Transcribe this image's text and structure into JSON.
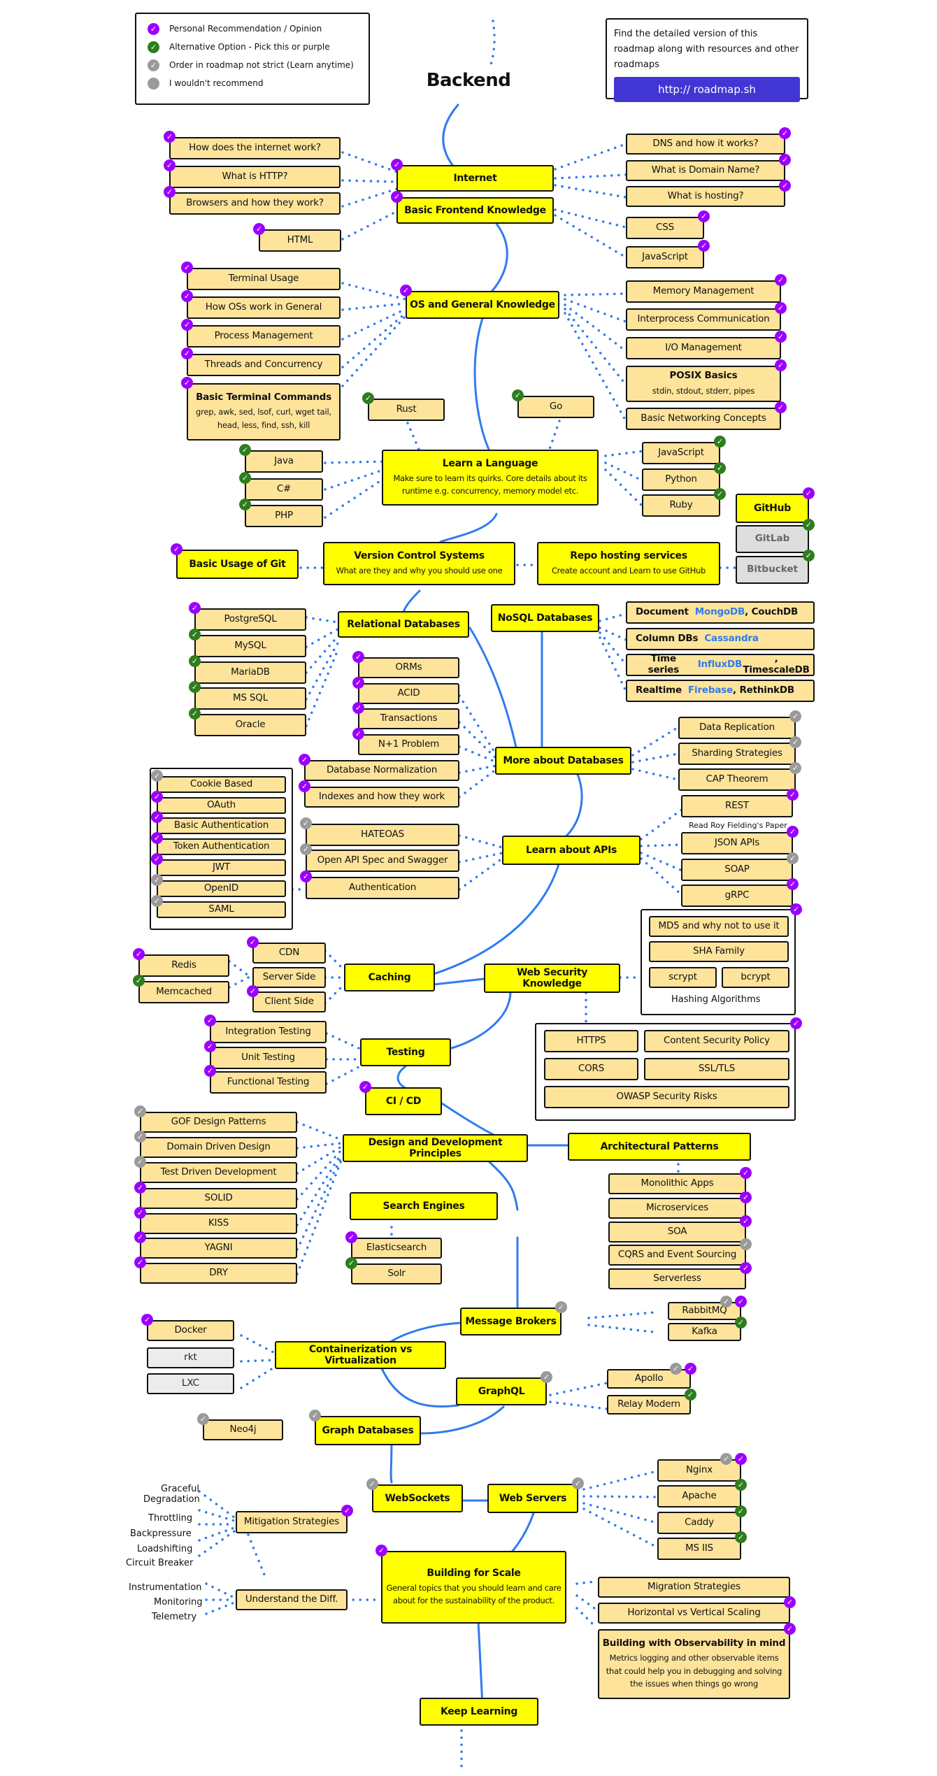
{
  "title": "Backend",
  "legend": [
    {
      "kind": "purple",
      "label": "Personal Recommendation / Opinion"
    },
    {
      "kind": "green",
      "label": "Alternative Option - Pick this or purple"
    },
    {
      "kind": "gray",
      "label": "Order in roadmap not strict (Learn anytime)"
    },
    {
      "kind": "dot",
      "label": "I wouldn't recommend"
    }
  ],
  "promo": {
    "text": "Find the detailed version of this roadmap along with resources and other roadmaps",
    "button": "http:// roadmap.sh"
  },
  "colors": {
    "main_node": "#ffff00",
    "sub_node": "#fee49b",
    "purple_badge": "#9b00ff",
    "green_badge": "#2e7d1e",
    "gray_badge": "#9a9a9a",
    "connector": "#2f7bf0",
    "promo_button": "#4136d4"
  },
  "nodes": {
    "internet": {
      "label": "Internet"
    },
    "how_internet": {
      "label": "How does the internet work?"
    },
    "http": {
      "label": "What is HTTP?"
    },
    "browsers": {
      "label": "Browsers and how they work?"
    },
    "dns": {
      "label": "DNS and how it works?"
    },
    "domain": {
      "label": "What is Domain Name?"
    },
    "hosting": {
      "label": "What is hosting?"
    },
    "frontend": {
      "label": "Basic Frontend Knowledge"
    },
    "html": {
      "label": "HTML"
    },
    "css": {
      "label": "CSS"
    },
    "js_fe": {
      "label": "JavaScript"
    },
    "os": {
      "label": "OS and General Knowledge"
    },
    "terminal": {
      "label": "Terminal Usage"
    },
    "how_os": {
      "label": "How OSs work in General"
    },
    "process": {
      "label": "Process Management"
    },
    "threads": {
      "label": "Threads and Concurrency"
    },
    "term_cmds": {
      "label": "Basic Terminal Commands",
      "desc": "grep, awk, sed, lsof, curl, wget tail, head, less, find, ssh, kill"
    },
    "memory": {
      "label": "Memory Management"
    },
    "ipc": {
      "label": "Interprocess Communication"
    },
    "io": {
      "label": "I/O Management"
    },
    "posix": {
      "label": "POSIX Basics",
      "desc": "stdin, stdout, stderr, pipes"
    },
    "networking": {
      "label": "Basic Networking Concepts"
    },
    "rust": {
      "label": "Rust"
    },
    "go": {
      "label": "Go"
    },
    "language": {
      "label": "Learn a Language",
      "desc": "Make sure to learn its quirks. Core details about its runtime e.g. concurrency, memory model etc."
    },
    "java": {
      "label": "Java"
    },
    "csharp": {
      "label": "C#"
    },
    "php": {
      "label": "PHP"
    },
    "js_be": {
      "label": "JavaScript"
    },
    "python": {
      "label": "Python"
    },
    "ruby": {
      "label": "Ruby"
    },
    "github": {
      "label": "GitHub"
    },
    "gitlab": {
      "label": "GitLab"
    },
    "bitbucket": {
      "label": "Bitbucket"
    },
    "git": {
      "label": "Basic Usage of Git"
    },
    "vcs": {
      "label": "Version Control Systems",
      "desc": "What are they and why you should use one"
    },
    "repo": {
      "label": "Repo hosting services",
      "desc": "Create account and Learn to use GitHub"
    },
    "relational": {
      "label": "Relational Databases"
    },
    "postgres": {
      "label": "PostgreSQL"
    },
    "mysql": {
      "label": "MySQL"
    },
    "mariadb": {
      "label": "MariaDB"
    },
    "mssql": {
      "label": "MS SQL"
    },
    "oracle": {
      "label": "Oracle"
    },
    "nosql": {
      "label": "NoSQL Databases"
    },
    "nosql_doc": {
      "label": "Document",
      "links": "MongoDB",
      "rest": ", CouchDB"
    },
    "nosql_col": {
      "label": "Column DBs",
      "links": "Cassandra",
      "rest": ""
    },
    "nosql_ts": {
      "label": "Time series",
      "links": "InfluxDB",
      "rest": ", TimescaleDB"
    },
    "nosql_rt": {
      "label": "Realtime",
      "links": "Firebase",
      "rest": ", RethinkDB"
    },
    "orms": {
      "label": "ORMs"
    },
    "acid": {
      "label": "ACID"
    },
    "transactions": {
      "label": "Transactions"
    },
    "n1": {
      "label": "N+1 Problem"
    },
    "normalization": {
      "label": "Database Normalization"
    },
    "indexes": {
      "label": "Indexes and how they work"
    },
    "more_db": {
      "label": "More about Databases"
    },
    "replication": {
      "label": "Data Replication"
    },
    "sharding": {
      "label": "Sharding Strategies"
    },
    "cap": {
      "label": "CAP Theorem"
    },
    "cookie": {
      "label": "Cookie Based"
    },
    "oauth": {
      "label": "OAuth"
    },
    "basic_auth": {
      "label": "Basic Authentication"
    },
    "token_auth": {
      "label": "Token Authentication"
    },
    "jwt": {
      "label": "JWT"
    },
    "openid": {
      "label": "OpenID"
    },
    "saml": {
      "label": "SAML"
    },
    "hateoas": {
      "label": "HATEOAS"
    },
    "openapi": {
      "label": "Open API Spec and Swagger"
    },
    "authentication": {
      "label": "Authentication"
    },
    "apis": {
      "label": "Learn about APIs"
    },
    "rest": {
      "label": "REST"
    },
    "rest_hint": {
      "label": "Read Roy Fielding's Paper"
    },
    "json_apis": {
      "label": "JSON APIs"
    },
    "soap": {
      "label": "SOAP"
    },
    "grpc": {
      "label": "gRPC"
    },
    "md5": {
      "label": "MD5 and why not to use it"
    },
    "sha": {
      "label": "SHA Family"
    },
    "scrypt": {
      "label": "scrypt"
    },
    "bcrypt": {
      "label": "bcrypt"
    },
    "hashing": {
      "label": "Hashing Algorithms"
    },
    "redis": {
      "label": "Redis"
    },
    "memcached": {
      "label": "Memcached"
    },
    "cdn": {
      "label": "CDN"
    },
    "server_side": {
      "label": "Server Side"
    },
    "client_side": {
      "label": "Client Side"
    },
    "caching": {
      "label": "Caching"
    },
    "web_security": {
      "label": "Web Security Knowledge"
    },
    "https": {
      "label": "HTTPS"
    },
    "csp": {
      "label": "Content Security Policy"
    },
    "cors": {
      "label": "CORS"
    },
    "ssl": {
      "label": "SSL/TLS"
    },
    "owasp": {
      "label": "OWASP Security Risks"
    },
    "integration": {
      "label": "Integration Testing"
    },
    "unit": {
      "label": "Unit Testing"
    },
    "functional": {
      "label": "Functional Testing"
    },
    "testing": {
      "label": "Testing"
    },
    "cicd": {
      "label": "CI / CD"
    },
    "gof": {
      "label": "GOF Design Patterns"
    },
    "ddd": {
      "label": "Domain Driven Design"
    },
    "tdd": {
      "label": "Test Driven Development"
    },
    "solid": {
      "label": "SOLID"
    },
    "kiss": {
      "label": "KISS"
    },
    "yagni": {
      "label": "YAGNI"
    },
    "dry": {
      "label": "DRY"
    },
    "design": {
      "label": "Design and Development Principles"
    },
    "arch": {
      "label": "Architectural Patterns"
    },
    "monolith": {
      "label": "Monolithic Apps"
    },
    "micro": {
      "label": "Microservices"
    },
    "soa": {
      "label": "SOA"
    },
    "cqrs": {
      "label": "CQRS and Event Sourcing"
    },
    "serverless": {
      "label": "Serverless"
    },
    "search": {
      "label": "Search Engines"
    },
    "elastic": {
      "label": "Elasticsearch"
    },
    "solr": {
      "label": "Solr"
    },
    "brokers": {
      "label": "Message Brokers"
    },
    "rabbitmq": {
      "label": "RabbitMQ"
    },
    "kafka": {
      "label": "Kafka"
    },
    "docker": {
      "label": "Docker"
    },
    "rkt": {
      "label": "rkt"
    },
    "lxc": {
      "label": "LXC"
    },
    "containers": {
      "label": "Containerization vs Virtualization"
    },
    "graphql": {
      "label": "GraphQL"
    },
    "apollo": {
      "label": "Apollo"
    },
    "relay": {
      "label": "Relay Modern"
    },
    "neo4j": {
      "label": "Neo4j"
    },
    "graphdb": {
      "label": "Graph Databases"
    },
    "websockets": {
      "label": "WebSockets"
    },
    "webservers": {
      "label": "Web Servers"
    },
    "nginx": {
      "label": "Nginx"
    },
    "apache": {
      "label": "Apache"
    },
    "caddy": {
      "label": "Caddy"
    },
    "msiis": {
      "label": "MS IIS"
    },
    "mitigation": {
      "label": "Mitigation Strategies"
    },
    "graceful": {
      "label": "Graceful Degradation"
    },
    "throttling": {
      "label": "Throttling"
    },
    "backpressure": {
      "label": "Backpressure"
    },
    "loadshifting": {
      "label": "Loadshifting"
    },
    "circuit": {
      "label": "Circuit Breaker"
    },
    "understand": {
      "label": "Understand the Diff."
    },
    "instrumentation": {
      "label": "Instrumentation"
    },
    "monitoring": {
      "label": "Monitoring"
    },
    "telemetry": {
      "label": "Telemetry"
    },
    "scale": {
      "label": "Building for Scale",
      "desc": "General topics that you should learn and care about for the sustainability of the product."
    },
    "migration": {
      "label": "Migration Strategies"
    },
    "hv_scaling": {
      "label": "Horizontal vs Vertical Scaling"
    },
    "observability": {
      "label": "Building with Observability in mind",
      "desc": "Metrics logging and other observable items that could help you in debugging and solving the issues when things go wrong"
    },
    "keep_learning": {
      "label": "Keep Learning"
    }
  }
}
